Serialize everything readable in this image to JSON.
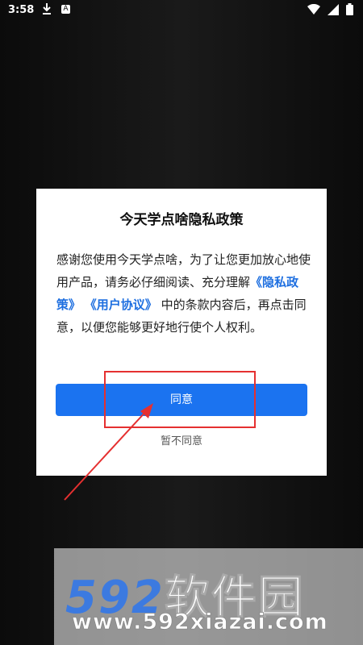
{
  "status_bar": {
    "time": "3:58",
    "download_icon": "download-icon",
    "a_icon_label": "A",
    "wifi_icon": "wifi-icon",
    "signal_icon": "signal-icon",
    "battery_icon": "battery-icon"
  },
  "dialog": {
    "title": "今天学点啥隐私政策",
    "body_part1": "感谢您使用今天学点啥，为了让您更加放心地使用产品，请务必仔细阅读、充分理解",
    "privacy_link": "《隐私政策》",
    "terms_link": "《用户协议》",
    "body_part2": "中的条款内容后，再点击同意，以便您能够更好地行使个人权利。",
    "agree_label": "同意",
    "disagree_label": "暂不同意"
  },
  "watermark": {
    "brand_number": "592",
    "brand_text": "软件园",
    "url": "www.592xiazai.com"
  },
  "colors": {
    "accent": "#1b73f0",
    "link": "#1e6fe0",
    "annotation": "#e53030"
  }
}
